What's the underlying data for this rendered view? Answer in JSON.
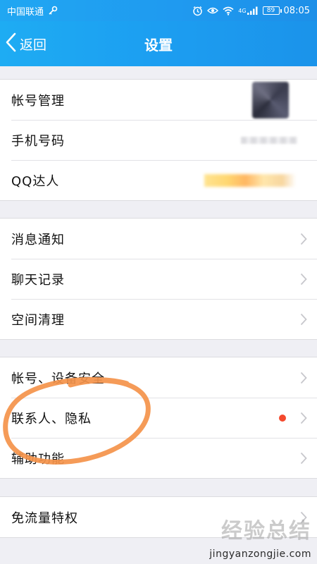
{
  "status_bar": {
    "carrier": "中国联通",
    "network_type": "4G",
    "battery": "89",
    "time": "08:05"
  },
  "nav": {
    "back_label": "返回",
    "title": "设置"
  },
  "groups": [
    {
      "items": [
        {
          "label": "帐号管理"
        },
        {
          "label": "手机号码"
        },
        {
          "label": "QQ达人"
        }
      ]
    },
    {
      "items": [
        {
          "label": "消息通知"
        },
        {
          "label": "聊天记录"
        },
        {
          "label": "空间清理"
        }
      ]
    },
    {
      "items": [
        {
          "label": "帐号、设备安全"
        },
        {
          "label": "联系人、隐私"
        },
        {
          "label": "辅助功能"
        }
      ]
    },
    {
      "items": [
        {
          "label": "免流量特权"
        }
      ]
    }
  ],
  "watermark": {
    "line1": "经验总结",
    "line2": "jingyanzongjie.com"
  },
  "colors": {
    "header_blue": "#1d9ef1",
    "annotation_orange": "#f4934a",
    "red_dot": "#f4492d"
  }
}
